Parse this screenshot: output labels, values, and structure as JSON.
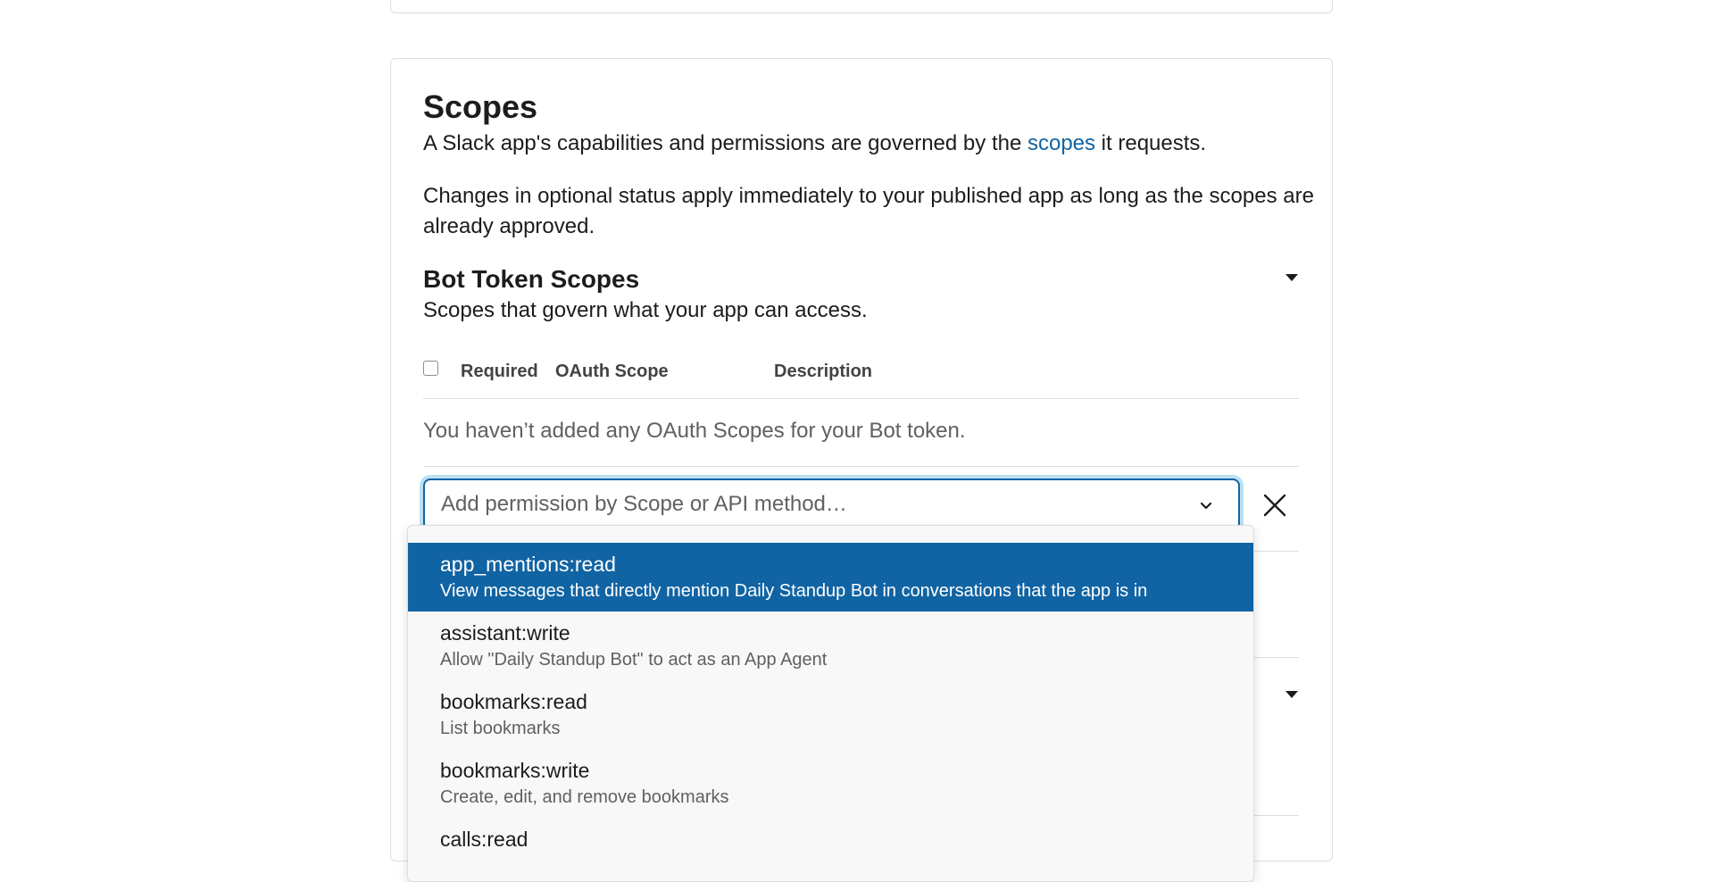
{
  "scopes_section": {
    "title": "Scopes",
    "intro_before_link": "A Slack app's capabilities and permissions are governed by the ",
    "intro_link": "scopes",
    "intro_after_link": " it requests.",
    "note": "Changes in optional status apply immediately to your published app as long as the scopes are already approved."
  },
  "bot_token_scopes": {
    "title": "Bot Token Scopes",
    "subtitle": "Scopes that govern what your app can access.",
    "columns": {
      "required": "Required",
      "oauth_scope": "OAuth Scope",
      "description": "Description"
    },
    "empty_message": "You haven’t added any OAuth Scopes for your Bot token."
  },
  "add_permission": {
    "placeholder": "Add permission by Scope or API method…",
    "value": ""
  },
  "dropdown": {
    "options": [
      {
        "name": "app_mentions:read",
        "description": "View messages that directly mention Daily Standup Bot in conversations that the app is in",
        "highlighted": true
      },
      {
        "name": "assistant:write",
        "description": "Allow \"Daily Standup Bot\" to act as an App Agent",
        "highlighted": false
      },
      {
        "name": "bookmarks:read",
        "description": "List bookmarks",
        "highlighted": false
      },
      {
        "name": "bookmarks:write",
        "description": "Create, edit, and remove bookmarks",
        "highlighted": false
      },
      {
        "name": "calls:read",
        "description": "",
        "highlighted": false
      }
    ]
  },
  "icons": {
    "collapse_caret": "caret-down-icon",
    "dropdown_chevron": "chevron-down-icon",
    "clear": "close-icon"
  },
  "colors": {
    "link": "#1264a3",
    "highlight": "#1164a3",
    "focus_ring": "#1d9bd1"
  }
}
